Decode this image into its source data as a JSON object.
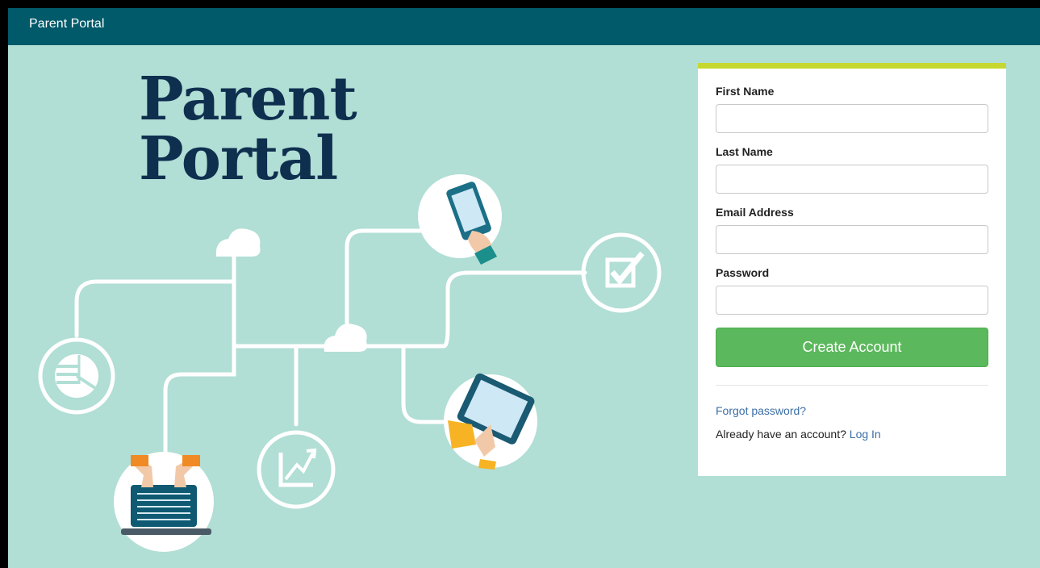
{
  "app": {
    "title": "Parent Portal"
  },
  "hero": {
    "line1": "Parent",
    "line2": "Portal"
  },
  "form": {
    "first_name_label": "First Name",
    "last_name_label": "Last Name",
    "email_label": "Email Address",
    "password_label": "Password",
    "first_name_value": "",
    "last_name_value": "",
    "email_value": "",
    "password_value": "",
    "submit_label": "Create Account",
    "forgot_label": "Forgot password?",
    "already_text": "Already have an account? ",
    "login_label": "Log In"
  },
  "colors": {
    "topbar": "#005a6a",
    "background": "#b1ded5",
    "hero_text": "#0f2f4f",
    "card_accent": "#c6d82f",
    "button": "#5cb85c",
    "link": "#3c6ea5"
  },
  "icons": [
    "cloud-icon",
    "pie-chart-icon",
    "laptop-hands-icon",
    "growth-chart-icon",
    "smartphone-hand-icon",
    "checkbox-icon",
    "tablet-hand-icon"
  ]
}
